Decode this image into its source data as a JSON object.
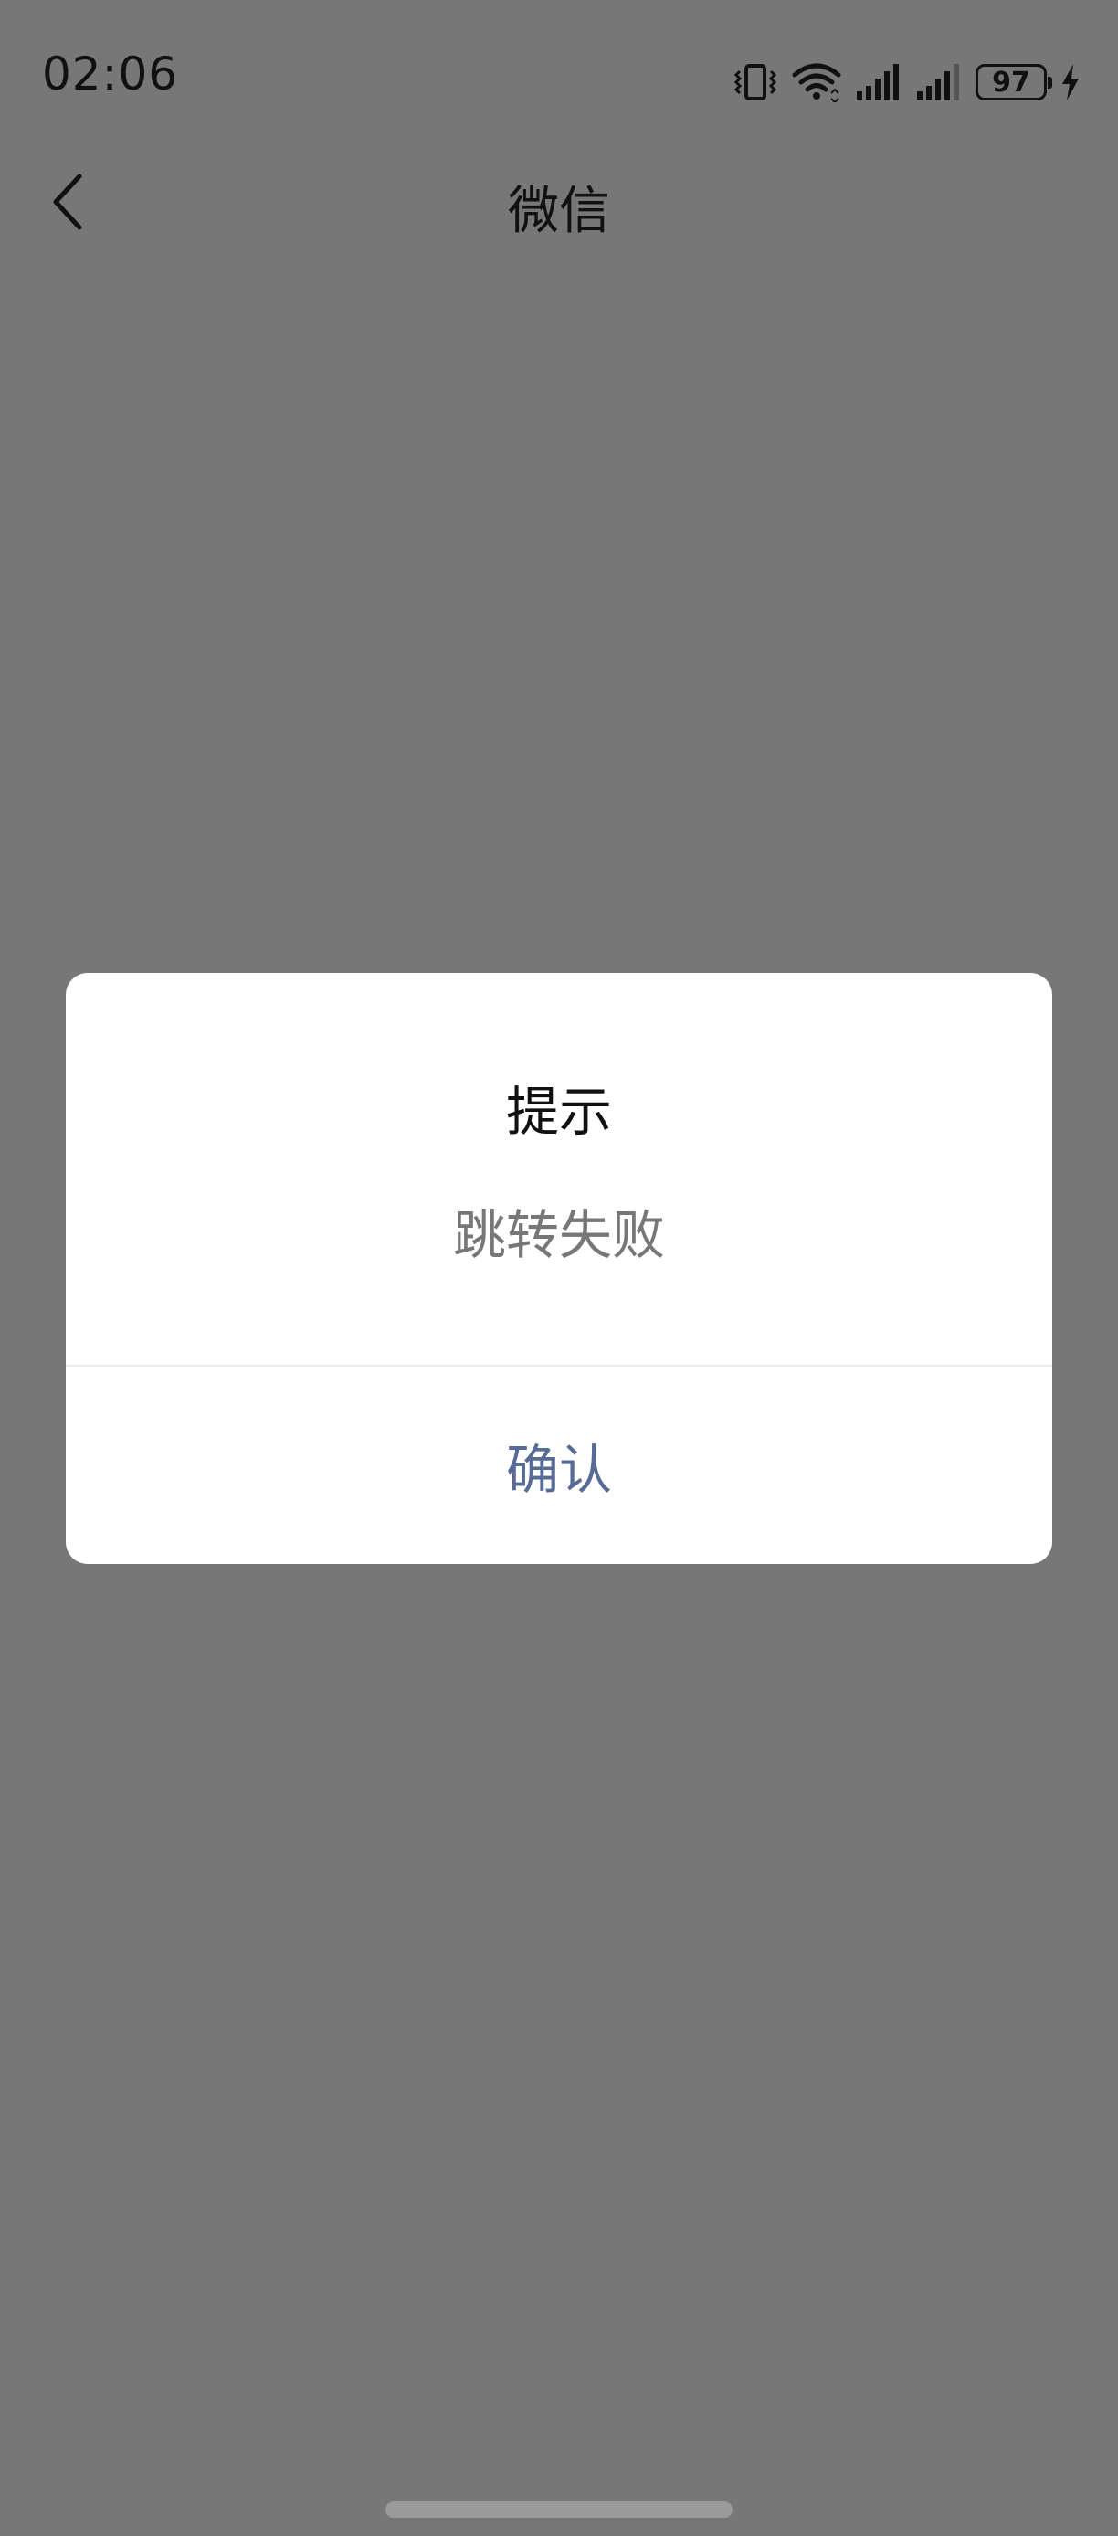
{
  "status_bar": {
    "time": "02:06",
    "battery_level": "97",
    "icons": [
      "vibrate-icon",
      "wifi-icon",
      "signal-1-icon",
      "signal-2-icon",
      "battery-icon",
      "charging-icon"
    ]
  },
  "nav": {
    "title": "微信",
    "back_icon": "chevron-left-icon"
  },
  "dialog": {
    "title": "提示",
    "message": "跳转失败",
    "confirm_label": "确认"
  },
  "colors": {
    "overlay": "#777777",
    "dialog_bg": "#ffffff",
    "confirm_text": "#576b95",
    "message_text": "#777777"
  }
}
